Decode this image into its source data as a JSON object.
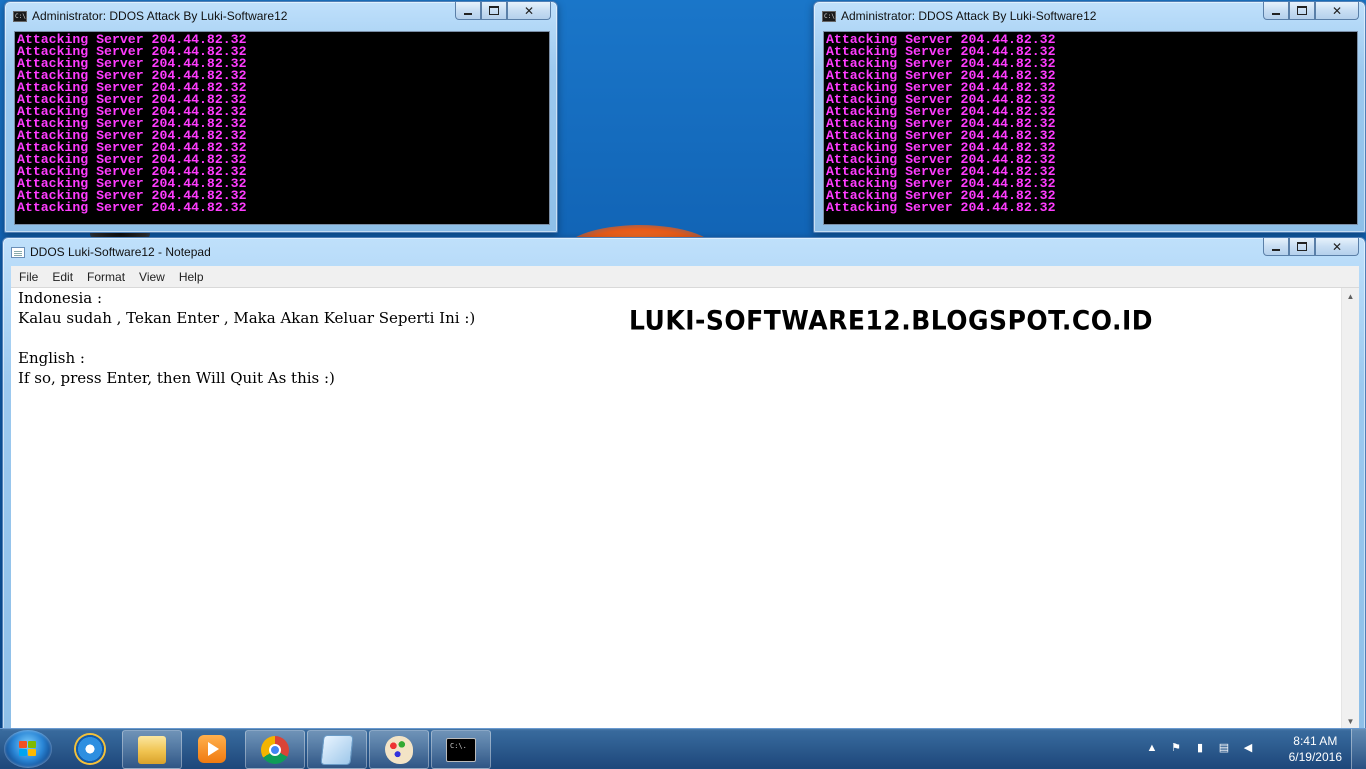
{
  "console_left": {
    "title": "Administrator:  DDOS Attack By Luki-Software12",
    "icon_text": "C:\\.",
    "output_line": "Attacking Server 204.44.82.32",
    "output_count": 15,
    "text_color": "#ff3cff"
  },
  "console_right": {
    "title": "Administrator:  DDOS Attack By Luki-Software12",
    "icon_text": "C:\\.",
    "output_line": "Attacking Server 204.44.82.32",
    "output_count": 15,
    "text_color": "#ff3cff"
  },
  "notepad": {
    "title": "DDOS Luki-Software12 - Notepad",
    "menu": [
      "File",
      "Edit",
      "Format",
      "View",
      "Help"
    ],
    "lines": [
      "Indonesia :",
      "Kalau sudah , Tekan Enter , Maka Akan Keluar Seperti Ini :)",
      "",
      "English :",
      "If so, press Enter, then Will Quit As this :)"
    ],
    "watermark": "LUKI-SOFTWARE12.BLOGSPOT.CO.ID"
  },
  "taskbar": {
    "start_icon": "windows-start-icon",
    "items": [
      {
        "icon": "internet-explorer-icon",
        "pinned": false
      },
      {
        "icon": "file-explorer-icon",
        "pinned": true
      },
      {
        "icon": "media-player-icon",
        "pinned": false
      },
      {
        "icon": "chrome-icon",
        "pinned": true
      },
      {
        "icon": "notepad-icon",
        "pinned": true
      },
      {
        "icon": "paint-icon",
        "pinned": true
      },
      {
        "icon": "command-prompt-icon",
        "pinned": true
      }
    ],
    "clock_time": "8:41 AM",
    "clock_date": "6/19/2016",
    "tray_icons": [
      "show-hidden-icons",
      "action-center-icon",
      "battery-icon",
      "network-icon",
      "volume-icon"
    ]
  }
}
